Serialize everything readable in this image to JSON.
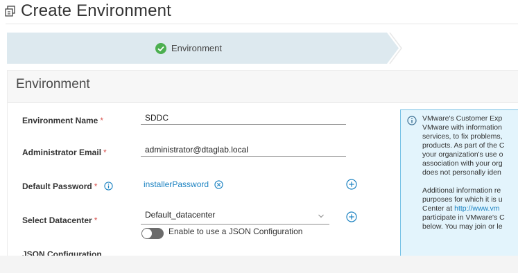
{
  "page": {
    "title": "Create Environment"
  },
  "stepper": {
    "steps": [
      {
        "label": "Environment",
        "status": "complete"
      }
    ]
  },
  "section": {
    "title": "Environment"
  },
  "form": {
    "environment_name": {
      "label": "Environment Name",
      "required_marker": "*",
      "value": "SDDC"
    },
    "admin_email": {
      "label": "Administrator Email",
      "required_marker": "*",
      "value": "administrator@dtaglab.local"
    },
    "default_password": {
      "label": "Default Password",
      "required_marker": "*",
      "value": "installerPassword"
    },
    "datacenter": {
      "label": "Select Datacenter",
      "required_marker": "*",
      "value": "Default_datacenter"
    },
    "json_config": {
      "label": "JSON Configuration",
      "toggle_text": "Enable to use a JSON Configuration",
      "enabled": false
    }
  },
  "info_box": {
    "line1": "VMware's Customer Exp",
    "line2": "VMware with information",
    "line3": "services, to fix problems,",
    "line4": "products. As part of the C",
    "line5": "your organization's use o",
    "line6": "association with your org",
    "line7": "does not personally iden",
    "line8": "Additional information re",
    "line9": "purposes for which it is u",
    "line10_prefix": "Center at ",
    "line10_link": "http://www.vm",
    "line11": "participate in VMware's C",
    "line12": "below. You may join or le"
  },
  "colors": {
    "step_active_bg": "#dde9ef",
    "success_green": "#4caf50",
    "link_blue": "#1b82c1",
    "info_bg": "#e3f4fc",
    "info_border": "#74c0e5",
    "required_red": "#d9534f"
  },
  "icons": {
    "title_icon": "copy-icon",
    "step_status_icon": "check-circle-icon",
    "info_icon": "info-circle-icon",
    "clear_icon": "close-circle-icon",
    "add_icon": "plus-circle-icon",
    "chevron_icon": "chevron-down-icon"
  }
}
